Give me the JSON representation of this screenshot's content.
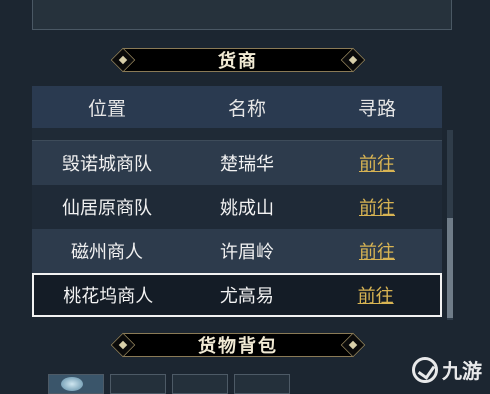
{
  "merchant_panel": {
    "title": "货商",
    "columns": [
      "位置",
      "名称",
      "寻路"
    ],
    "rows": [
      {
        "location": "毁诺城商队",
        "name": "楚瑞华",
        "action": "前往"
      },
      {
        "location": "仙居原商队",
        "name": "姚成山",
        "action": "前往"
      },
      {
        "location": "磁州商人",
        "name": "许眉岭",
        "action": "前往"
      },
      {
        "location": "桃花坞商人",
        "name": "尤高易",
        "action": "前往"
      }
    ]
  },
  "inventory_panel": {
    "title": "货物背包"
  },
  "watermark": {
    "text": "九游"
  },
  "colors": {
    "background": "#1c2631",
    "header": "#2a3a50",
    "link": "#d8b453",
    "banner": "#000000"
  }
}
